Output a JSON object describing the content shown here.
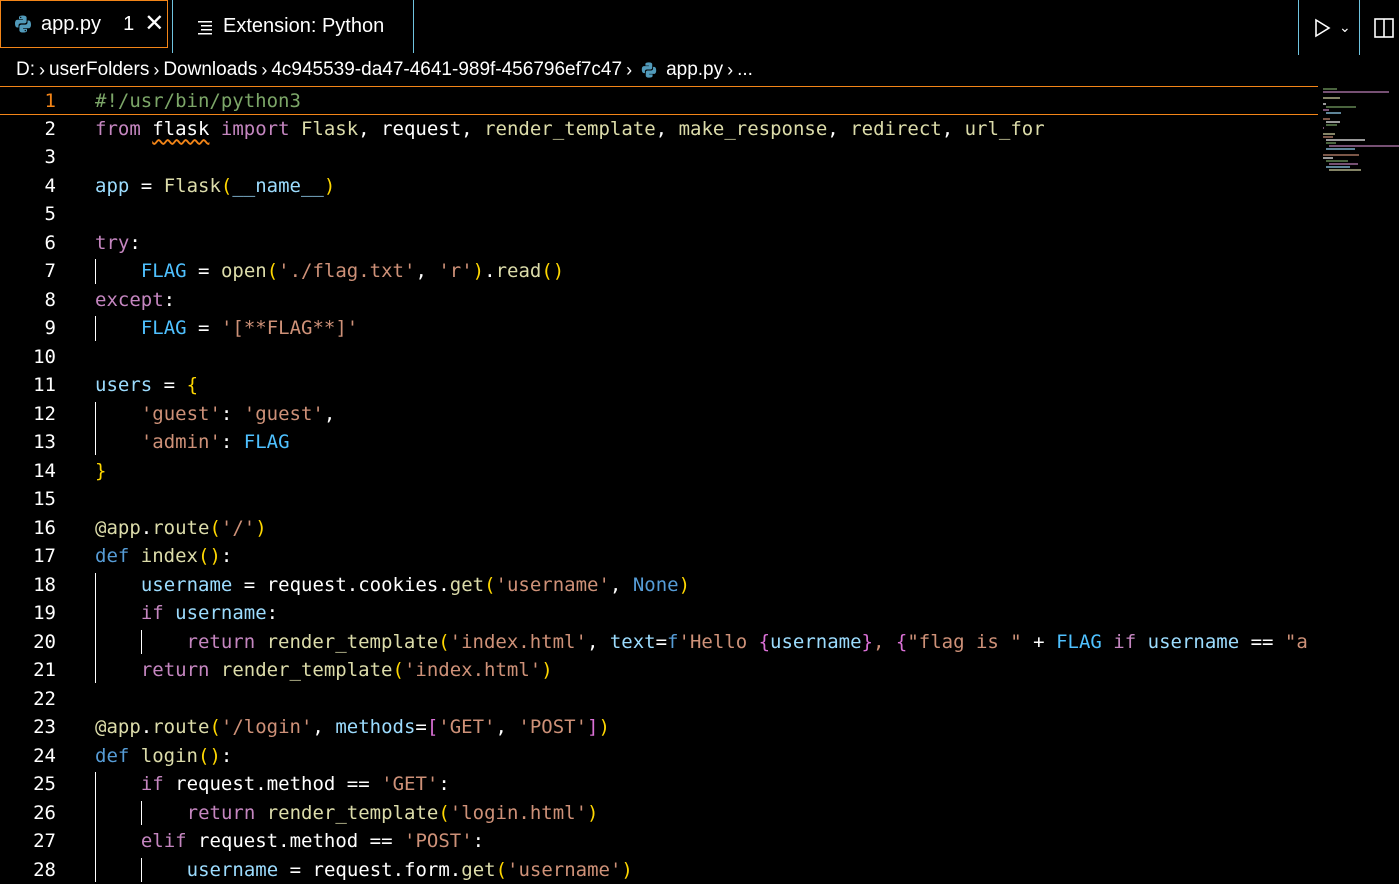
{
  "tabs": [
    {
      "label": "app.py",
      "problems": "1",
      "active": true
    },
    {
      "label": "Extension: Python",
      "active": false
    }
  ],
  "breadcrumb": [
    "D:",
    "userFolders",
    "Downloads",
    "4c945539-da47-4641-989f-456796ef7c47",
    "app.py",
    "..."
  ],
  "editor": {
    "current_line": 1,
    "lines": [
      {
        "n": "1",
        "text": "#!/usr/bin/python3"
      },
      {
        "n": "2",
        "text": "from flask import Flask, request, render_template, make_response, redirect, url_for"
      },
      {
        "n": "3",
        "text": ""
      },
      {
        "n": "4",
        "text": "app = Flask(__name__)"
      },
      {
        "n": "5",
        "text": ""
      },
      {
        "n": "6",
        "text": "try:"
      },
      {
        "n": "7",
        "text": "    FLAG = open('./flag.txt', 'r').read()"
      },
      {
        "n": "8",
        "text": "except:"
      },
      {
        "n": "9",
        "text": "    FLAG = '[**FLAG**]'"
      },
      {
        "n": "10",
        "text": ""
      },
      {
        "n": "11",
        "text": "users = {"
      },
      {
        "n": "12",
        "text": "    'guest': 'guest',"
      },
      {
        "n": "13",
        "text": "    'admin': FLAG"
      },
      {
        "n": "14",
        "text": "}"
      },
      {
        "n": "15",
        "text": ""
      },
      {
        "n": "16",
        "text": "@app.route('/')"
      },
      {
        "n": "17",
        "text": "def index():"
      },
      {
        "n": "18",
        "text": "    username = request.cookies.get('username', None)"
      },
      {
        "n": "19",
        "text": "    if username:"
      },
      {
        "n": "20",
        "text": "        return render_template('index.html', text=f'Hello {username}, {\"flag is \" + FLAG if username == \"a"
      },
      {
        "n": "21",
        "text": "    return render_template('index.html')"
      },
      {
        "n": "22",
        "text": ""
      },
      {
        "n": "23",
        "text": "@app.route('/login', methods=['GET', 'POST'])"
      },
      {
        "n": "24",
        "text": "def login():"
      },
      {
        "n": "25",
        "text": "    if request.method == 'GET':"
      },
      {
        "n": "26",
        "text": "        return render_template('login.html')"
      },
      {
        "n": "27",
        "text": "    elif request.method == 'POST':"
      },
      {
        "n": "28",
        "text": "        username = request.form.get('username')"
      }
    ]
  },
  "colors": {
    "focus_border": "#f38518",
    "contrast_border": "#6fc3df",
    "background": "#000000"
  },
  "icons": [
    "python-file-icon",
    "preview-icon",
    "run-icon",
    "chevron-down-icon",
    "split-editor-icon",
    "chevron-right-icon"
  ]
}
